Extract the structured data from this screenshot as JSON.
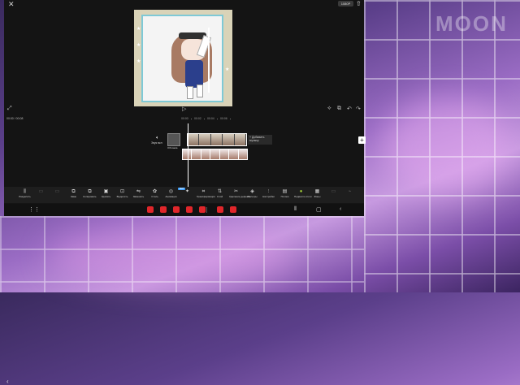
{
  "background": {
    "watermark": "MOON"
  },
  "editor": {
    "resolution_label": "1080P",
    "close_icon": "close-icon",
    "export_icon": "export-icon"
  },
  "timeline": {
    "timecode": "00:00 / 00:08",
    "ruler_marks": [
      "00:00",
      "00:02",
      "00:04",
      "00:06"
    ],
    "audio_toggle_label": "Звук вкл",
    "cover_label": "Обложка",
    "add_music_label": "+ Добавить музыку"
  },
  "toolbar": {
    "new_badge": "NEW",
    "tools": [
      {
        "label": "Разделить",
        "icon": "split-icon",
        "symbol": "⫼",
        "dim": false
      },
      {
        "label": "",
        "icon": "disabled-icon",
        "symbol": "▭",
        "dim": true
      },
      {
        "label": "",
        "icon": "disabled-icon",
        "symbol": "▭",
        "dim": true
      },
      {
        "label": "Заме",
        "icon": "replace-icon",
        "symbol": "⧉",
        "dim": false
      },
      {
        "label": "Копировать",
        "icon": "copy-icon",
        "symbol": "⧉",
        "dim": false
      },
      {
        "label": "Удалить",
        "icon": "delete-icon",
        "symbol": "▣",
        "dim": false
      },
      {
        "label": "Выделить",
        "icon": "select-icon",
        "symbol": "⊡",
        "dim": false
      },
      {
        "label": "Заменить",
        "icon": "swap-icon",
        "symbol": "⇋",
        "dim": false
      },
      {
        "label": "Стиль",
        "icon": "style-icon",
        "symbol": "✿",
        "dim": false
      },
      {
        "label": "Анимация",
        "icon": "animation-icon",
        "symbol": "◎",
        "dim": false
      },
      {
        "label": "",
        "icon": "effect-icon",
        "symbol": "✦",
        "dim": false
      },
      {
        "label": "Трансформация",
        "icon": "crop-icon",
        "symbol": "⌗",
        "dim": false
      },
      {
        "label": "Слой",
        "icon": "layer-icon",
        "symbol": "⇅",
        "dim": false
      },
      {
        "label": "Удаление дефекта",
        "icon": "remove-defect-icon",
        "symbol": "✂",
        "dim": false
      },
      {
        "label": "Фильтры",
        "icon": "filters-icon",
        "symbol": "◈",
        "dim": false
      },
      {
        "label": "Настройки",
        "icon": "adjust-icon",
        "symbol": "⫶",
        "dim": false
      },
      {
        "label": "Потоки",
        "icon": "streams-icon",
        "symbol": "▤",
        "dim": false
      },
      {
        "label": "Подвести итоги",
        "icon": "summary-icon",
        "symbol": "●",
        "dim": false
      },
      {
        "label": "Фоны",
        "icon": "backgrounds-icon",
        "symbol": "▦",
        "dim": false
      },
      {
        "label": "",
        "icon": "disabled-icon",
        "symbol": "▭",
        "dim": true
      },
      {
        "label": "",
        "icon": "disabled-icon",
        "symbol": "⌁",
        "dim": true
      }
    ]
  },
  "navbar": {
    "apps_icon": "apps-grid-icon",
    "dock_apps": [
      {
        "icon": "app-icon-1",
        "color": "#e0262a"
      },
      {
        "icon": "app-icon-2",
        "color": "#e0262a"
      },
      {
        "icon": "app-icon-3",
        "color": "#e0262a"
      },
      {
        "icon": "app-icon-4",
        "color": "#e0262a"
      },
      {
        "icon": "app-icon-5",
        "color": "#e0262a"
      },
      {
        "icon": "app-icon-6",
        "color": "#e0262a"
      },
      {
        "icon": "app-icon-7",
        "color": "#e0262a"
      }
    ]
  }
}
